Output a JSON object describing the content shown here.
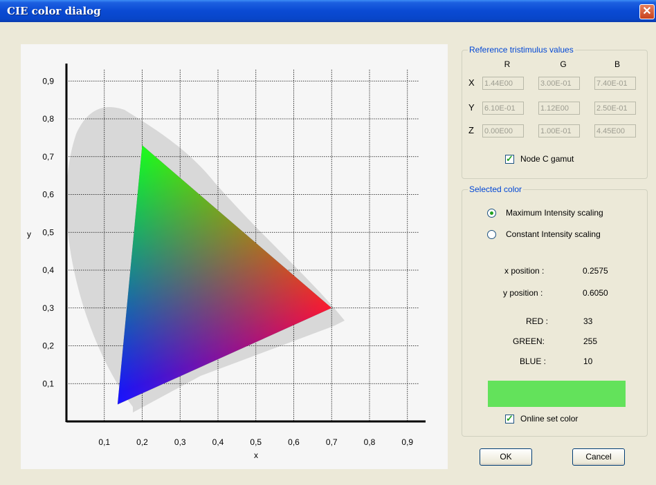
{
  "window": {
    "title": "CIE color dialog",
    "close_symbol": "✕"
  },
  "chart_data": {
    "type": "scatter",
    "title": "",
    "xlabel": "x",
    "ylabel": "y",
    "xlim": [
      0,
      1.0
    ],
    "ylim": [
      0,
      1.0
    ],
    "xticks": [
      "0,1",
      "0,2",
      "0,3",
      "0,4",
      "0,5",
      "0,6",
      "0,7",
      "0,8",
      "0,9"
    ],
    "yticks": [
      "0,1",
      "0,2",
      "0,3",
      "0,4",
      "0,5",
      "0,6",
      "0,7",
      "0,8",
      "0,9"
    ],
    "grid": true,
    "gamut_triangle": [
      {
        "name": "red",
        "x": 0.7,
        "y": 0.3,
        "color": "#ff0000"
      },
      {
        "name": "green",
        "x": 0.2,
        "y": 0.73,
        "color": "#00ff00"
      },
      {
        "name": "blue",
        "x": 0.135,
        "y": 0.045,
        "color": "#0000ff"
      }
    ],
    "spectral_locus_color": "#d8d8d8"
  },
  "reference": {
    "title": "Reference tristimulus values",
    "columns": [
      "R",
      "G",
      "B"
    ],
    "rows": [
      {
        "label": "X",
        "values": [
          "1.44E00",
          "3.00E-01",
          "7.40E-01"
        ]
      },
      {
        "label": "Y",
        "values": [
          "6.10E-01",
          "1.12E00",
          "2.50E-01"
        ]
      },
      {
        "label": "Z",
        "values": [
          "0.00E00",
          "1.00E-01",
          "4.45E00"
        ]
      }
    ],
    "node_c_gamut": {
      "label": "Node C gamut",
      "checked": true
    }
  },
  "selected": {
    "title": "Selected color",
    "scaling_options": [
      {
        "label": "Maximum Intensity scaling",
        "selected": true
      },
      {
        "label": "Constant Intensity scaling",
        "selected": false
      }
    ],
    "x_position_label": "x position :",
    "x_position_value": "0.2575",
    "y_position_label": "y position :",
    "y_position_value": "0.6050",
    "red_label": "RED :",
    "red_value": "33",
    "green_label": "GREEN:",
    "green_value": "255",
    "blue_label": "BLUE :",
    "blue_value": "10",
    "swatch_color": "#63e25b",
    "online_set_color": {
      "label": "Online set color",
      "checked": true
    }
  },
  "buttons": {
    "ok": "OK",
    "cancel": "Cancel"
  },
  "check_mark": "✓"
}
